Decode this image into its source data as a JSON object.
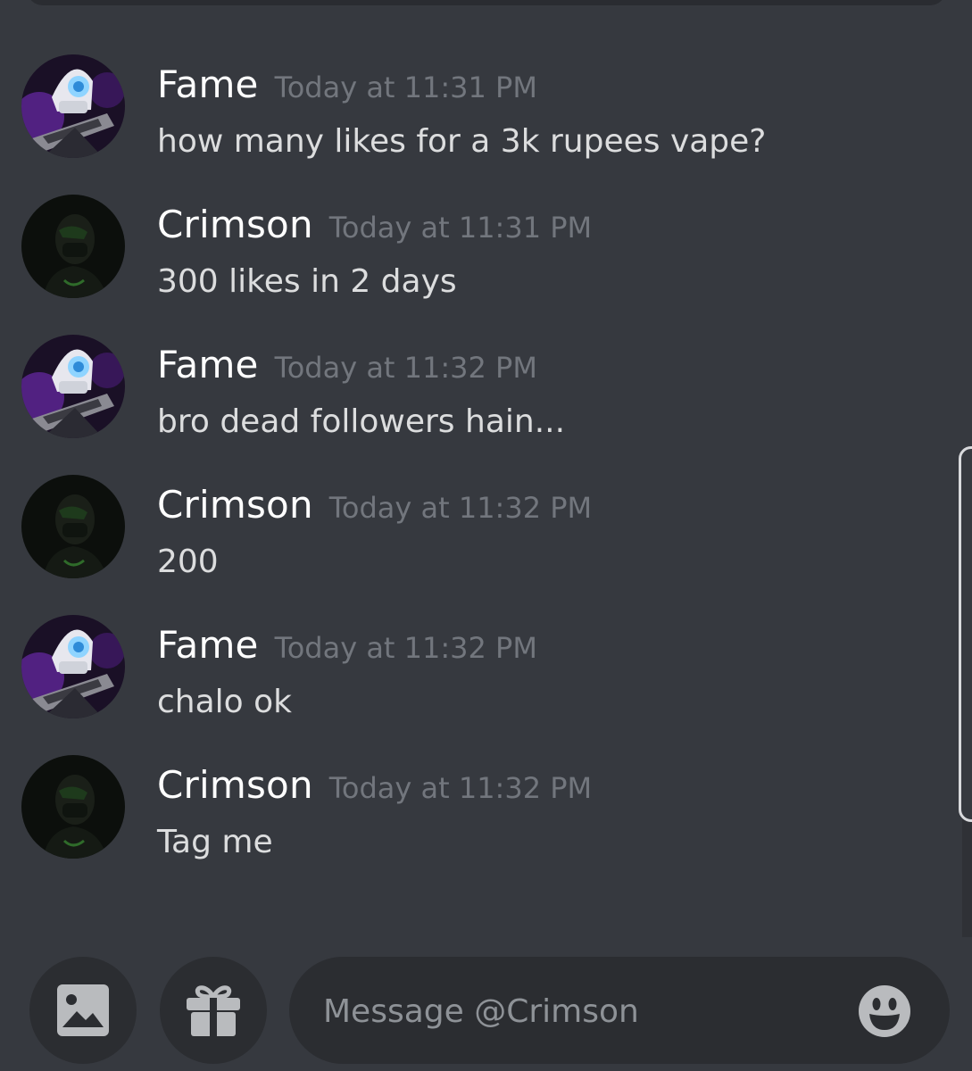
{
  "conversation": {
    "messages": [
      {
        "author": "Fame",
        "timestamp": "Today at 11:31 PM",
        "content": "how many likes for a 3k rupees vape?",
        "avatar": "fame-avatar"
      },
      {
        "author": "Crimson",
        "timestamp": "Today at 11:31 PM",
        "content": "300 likes in 2 days",
        "avatar": "crimson-avatar"
      },
      {
        "author": "Fame",
        "timestamp": "Today at 11:32 PM",
        "content": "bro dead followers hain...",
        "avatar": "fame-avatar"
      },
      {
        "author": "Crimson",
        "timestamp": "Today at 11:32 PM",
        "content": "200",
        "avatar": "crimson-avatar"
      },
      {
        "author": "Fame",
        "timestamp": "Today at 11:32 PM",
        "content": "chalo ok",
        "avatar": "fame-avatar"
      },
      {
        "author": "Crimson",
        "timestamp": "Today at 11:32 PM",
        "content": "Tag me",
        "avatar": "crimson-avatar"
      }
    ]
  },
  "composer": {
    "placeholder": "Message @Crimson",
    "value": "",
    "attach_icon": "image-icon",
    "gift_icon": "gift-icon",
    "emoji_icon": "emoji-icon"
  },
  "colors": {
    "background": "#36393f",
    "username": "#ffffff",
    "timestamp": "#72767d",
    "message_text": "#dcddde",
    "input_background": "#2b2d31"
  }
}
